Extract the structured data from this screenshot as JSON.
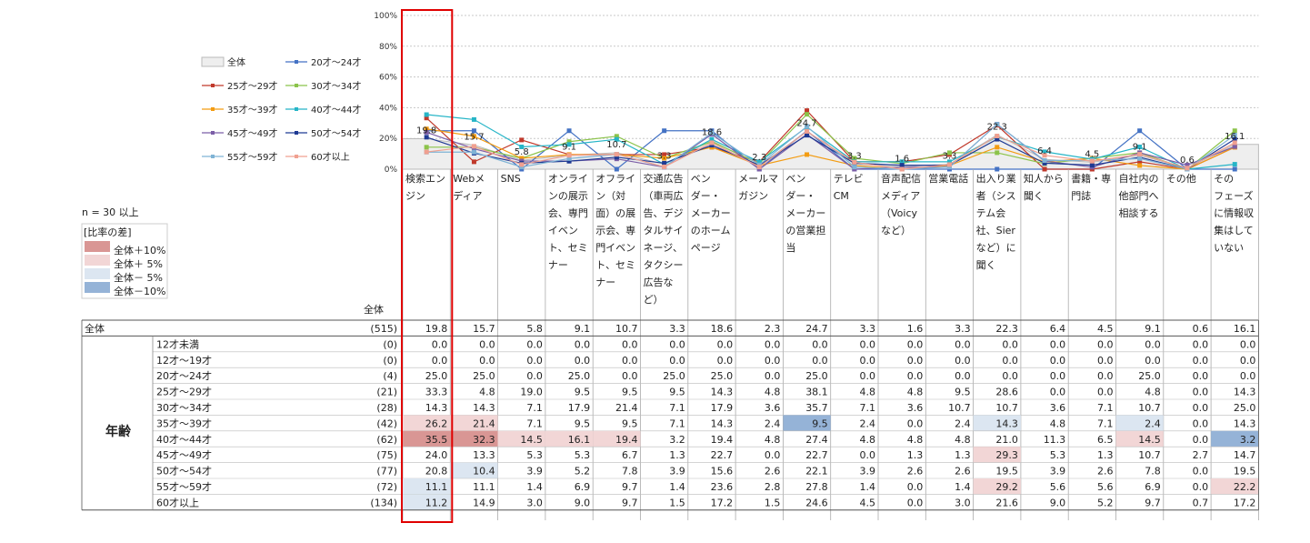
{
  "sample_note": "n = 30 以上",
  "diff_legend": {
    "title": "[比率の差]",
    "items": [
      {
        "label": "全体＋10%",
        "color": "#d99694"
      },
      {
        "label": "全体＋ 5%",
        "color": "#f2d6d6"
      },
      {
        "label": "全体－ 5%",
        "color": "#dce6f1"
      },
      {
        "label": "全体－10%",
        "color": "#95b3d7"
      }
    ]
  },
  "total_header": "全体",
  "group_label": "年齢",
  "colors": {
    "overall_fill": "#eeeeee",
    "highlight_box": "#e00000",
    "grid": "#c8c8c8"
  },
  "chart_data": {
    "type": "line",
    "yticks": [
      "100%",
      "80%",
      "60%",
      "40%",
      "20%",
      "0%"
    ],
    "ylim": [
      0,
      100
    ],
    "categories": [
      "検索エンジン",
      "Webメディア",
      "SNS",
      "オンラインの展示会、専門イベント、セミナー",
      "オフライン（対面）の展示会、専門イベント、セミナー",
      "交通広告（車両広告、デジタルサイネージ、タクシー広告など）",
      "ベンダー・メーカーのホームページ",
      "メールマガジン",
      "ベンダー・メーカーの営業担当",
      "テレビCM",
      "音声配信メディア（Voicyなど）",
      "営業電話",
      "出入り業者（システム会社、Sierなど）に聞く",
      "知人から聞く",
      "書籍・専門誌",
      "自社内の他部門へ相談する",
      "その他",
      "そのフェーズに情報収集はしていない"
    ],
    "category_lines": [
      [
        "検索エン",
        "ジン"
      ],
      [
        "Webメ",
        "ディア"
      ],
      [
        "SNS"
      ],
      [
        "オンライ",
        "ンの展示",
        "会、専門",
        "イベン",
        "ト、セミ",
        "ナー"
      ],
      [
        "オフライ",
        "ン（対",
        "面）の展",
        "示会、専",
        "門イベン",
        "ト、セミ",
        "ナー"
      ],
      [
        "交通広告",
        "（車両広",
        "告、デジ",
        "タルサイ",
        "ネージ、",
        "タクシー",
        "広告な",
        "ど）"
      ],
      [
        "ベン",
        "ダー・",
        "メーカー",
        "のホーム",
        "ページ"
      ],
      [
        "メールマ",
        "ガジン"
      ],
      [
        "ベン",
        "ダー・",
        "メーカー",
        "の営業担",
        "当"
      ],
      [
        "テレビ",
        "CM"
      ],
      [
        "音声配信",
        "メディア",
        "（Voicy",
        "など）"
      ],
      [
        "営業電話"
      ],
      [
        "出入り業",
        "者（シス",
        "テム会",
        "社、Sier",
        "など）に",
        "聞く"
      ],
      [
        "知人から",
        "聞く"
      ],
      [
        "書籍・専",
        "門誌"
      ],
      [
        "自社内の",
        "他部門へ",
        "相談する"
      ],
      [
        "その他"
      ],
      [
        "その",
        "フェーズ",
        "に情報収",
        "集はして",
        "いない"
      ]
    ],
    "overall": {
      "name": "全体",
      "n": "(515)",
      "values": [
        19.8,
        15.7,
        5.8,
        9.1,
        10.7,
        3.3,
        18.6,
        2.3,
        24.7,
        3.3,
        1.6,
        3.3,
        22.3,
        6.4,
        4.5,
        9.1,
        0.6,
        16.1
      ],
      "labels": [
        "19.8",
        "15.7",
        "5.8",
        "9.1",
        "10.7",
        "3.3",
        "18.6",
        "2.3",
        "24.7",
        "3.3",
        "1.6",
        "3.3",
        "22.3",
        "6.4",
        "4.5",
        "9.1",
        "0.6",
        "16.1"
      ]
    },
    "rows": [
      {
        "name": "12才未満",
        "n": "(0)",
        "in_chart": false,
        "color": "#999999",
        "values": [
          0.0,
          0.0,
          0.0,
          0.0,
          0.0,
          0.0,
          0.0,
          0.0,
          0.0,
          0.0,
          0.0,
          0.0,
          0.0,
          0.0,
          0.0,
          0.0,
          0.0,
          0.0
        ],
        "diff": [
          0,
          0,
          0,
          0,
          0,
          0,
          0,
          0,
          0,
          0,
          0,
          0,
          0,
          0,
          0,
          0,
          0,
          0
        ]
      },
      {
        "name": "12才～19才",
        "n": "(0)",
        "in_chart": false,
        "color": "#999999",
        "values": [
          0.0,
          0.0,
          0.0,
          0.0,
          0.0,
          0.0,
          0.0,
          0.0,
          0.0,
          0.0,
          0.0,
          0.0,
          0.0,
          0.0,
          0.0,
          0.0,
          0.0,
          0.0
        ],
        "diff": [
          0,
          0,
          0,
          0,
          0,
          0,
          0,
          0,
          0,
          0,
          0,
          0,
          0,
          0,
          0,
          0,
          0,
          0
        ]
      },
      {
        "name": "20才～24才",
        "n": "(4)",
        "in_chart": true,
        "color": "#4472c4",
        "values": [
          25.0,
          25.0,
          0.0,
          25.0,
          0.0,
          25.0,
          25.0,
          0.0,
          25.0,
          0.0,
          0.0,
          0.0,
          0.0,
          0.0,
          0.0,
          25.0,
          0.0,
          0.0
        ],
        "diff": [
          0,
          0,
          0,
          0,
          0,
          0,
          0,
          0,
          0,
          0,
          0,
          0,
          0,
          0,
          0,
          0,
          0,
          0
        ]
      },
      {
        "name": "25才～29才",
        "n": "(21)",
        "in_chart": true,
        "color": "#c0392b",
        "values": [
          33.3,
          4.8,
          19.0,
          9.5,
          9.5,
          9.5,
          14.3,
          4.8,
          38.1,
          4.8,
          4.8,
          9.5,
          28.6,
          0.0,
          0.0,
          4.8,
          0.0,
          14.3
        ],
        "diff": [
          0,
          0,
          0,
          0,
          0,
          0,
          0,
          0,
          0,
          0,
          0,
          0,
          0,
          0,
          0,
          0,
          0,
          0
        ]
      },
      {
        "name": "30才～34才",
        "n": "(28)",
        "in_chart": true,
        "color": "#8bc34a",
        "values": [
          14.3,
          14.3,
          7.1,
          17.9,
          21.4,
          7.1,
          17.9,
          3.6,
          35.7,
          7.1,
          3.6,
          10.7,
          10.7,
          3.6,
          7.1,
          10.7,
          0.0,
          25.0
        ],
        "diff": [
          0,
          0,
          0,
          0,
          0,
          0,
          0,
          0,
          0,
          0,
          0,
          0,
          0,
          0,
          0,
          0,
          0,
          0
        ]
      },
      {
        "name": "35才～39才",
        "n": "(42)",
        "in_chart": true,
        "color": "#f39c12",
        "values": [
          26.2,
          21.4,
          7.1,
          9.5,
          9.5,
          7.1,
          14.3,
          2.4,
          9.5,
          2.4,
          0.0,
          2.4,
          14.3,
          4.8,
          7.1,
          2.4,
          0.0,
          14.3
        ],
        "diff": [
          1,
          1,
          0,
          0,
          0,
          0,
          0,
          0,
          -2,
          0,
          0,
          0,
          -1,
          0,
          0,
          -1,
          0,
          0
        ]
      },
      {
        "name": "40才～44才",
        "n": "(62)",
        "in_chart": true,
        "color": "#26b5c7",
        "values": [
          35.5,
          32.3,
          14.5,
          16.1,
          19.4,
          3.2,
          19.4,
          4.8,
          27.4,
          4.8,
          4.8,
          4.8,
          21.0,
          11.3,
          6.5,
          14.5,
          0.0,
          3.2
        ],
        "diff": [
          2,
          2,
          1,
          1,
          1,
          0,
          0,
          0,
          0,
          0,
          0,
          0,
          0,
          0,
          0,
          1,
          0,
          -2
        ]
      },
      {
        "name": "45才～49才",
        "n": "(75)",
        "in_chart": true,
        "color": "#7b5ea7",
        "values": [
          24.0,
          13.3,
          5.3,
          5.3,
          6.7,
          1.3,
          22.7,
          0.0,
          22.7,
          0.0,
          1.3,
          1.3,
          29.3,
          5.3,
          1.3,
          10.7,
          2.7,
          14.7
        ],
        "diff": [
          0,
          0,
          0,
          0,
          0,
          0,
          0,
          0,
          0,
          0,
          0,
          0,
          1,
          0,
          0,
          0,
          0,
          0
        ]
      },
      {
        "name": "50才～54才",
        "n": "(77)",
        "in_chart": true,
        "color": "#1f3a93",
        "values": [
          20.8,
          10.4,
          3.9,
          5.2,
          7.8,
          3.9,
          15.6,
          2.6,
          22.1,
          3.9,
          2.6,
          2.6,
          19.5,
          3.9,
          2.6,
          7.8,
          0.0,
          19.5
        ],
        "diff": [
          0,
          -1,
          0,
          0,
          0,
          0,
          0,
          0,
          0,
          0,
          0,
          0,
          0,
          0,
          0,
          0,
          0,
          0
        ]
      },
      {
        "name": "55才～59才",
        "n": "(72)",
        "in_chart": true,
        "color": "#7fb3d5",
        "values": [
          11.1,
          11.1,
          1.4,
          6.9,
          9.7,
          1.4,
          23.6,
          2.8,
          27.8,
          1.4,
          0.0,
          1.4,
          29.2,
          5.6,
          5.6,
          6.9,
          0.0,
          22.2
        ],
        "diff": [
          -1,
          0,
          0,
          0,
          0,
          0,
          0,
          0,
          0,
          0,
          0,
          0,
          1,
          0,
          0,
          0,
          0,
          1
        ]
      },
      {
        "name": "60才以上",
        "n": "(134)",
        "in_chart": true,
        "color": "#f0a090",
        "values": [
          11.2,
          14.9,
          3.0,
          9.0,
          9.7,
          1.5,
          17.2,
          1.5,
          24.6,
          4.5,
          0.0,
          3.0,
          21.6,
          9.0,
          5.2,
          9.7,
          0.7,
          17.2
        ],
        "diff": [
          -1,
          0,
          0,
          0,
          0,
          0,
          0,
          0,
          0,
          0,
          0,
          0,
          0,
          0,
          0,
          0,
          0,
          0
        ]
      }
    ],
    "display": [
      [
        "19.8",
        "15.7",
        "5.8",
        "9.1",
        "10.7",
        "3.3",
        "18.6",
        "2.3",
        "24.7",
        "3.3",
        "1.6",
        "3.3",
        "22.3",
        "6.4",
        "4.5",
        "9.1",
        "0.6",
        "16.1"
      ],
      [
        "0.0",
        "0.0",
        "0.0",
        "0.0",
        "0.0",
        "0.0",
        "0.0",
        "0.0",
        "0.0",
        "0.0",
        "0.0",
        "0.0",
        "0.0",
        "0.0",
        "0.0",
        "0.0",
        "0.0",
        "0.0"
      ],
      [
        "0.0",
        "0.0",
        "0.0",
        "0.0",
        "0.0",
        "0.0",
        "0.0",
        "0.0",
        "0.0",
        "0.0",
        "0.0",
        "0.0",
        "0.0",
        "0.0",
        "0.0",
        "0.0",
        "0.0",
        "0.0"
      ],
      [
        "25.0",
        "25.0",
        "0.0",
        "25.0",
        "0.0",
        "25.0",
        "25.0",
        "0.0",
        "25.0",
        "0.0",
        "0.0",
        "0.0",
        "0.0",
        "0.0",
        "0.0",
        "25.0",
        "0.0",
        "0.0"
      ],
      [
        "33.3",
        "4.8",
        "19.0",
        "9.5",
        "9.5",
        "9.5",
        "14.3",
        "4.8",
        "38.1",
        "4.8",
        "4.8",
        "9.5",
        "28.6",
        "0.0",
        "0.0",
        "4.8",
        "0.0",
        "14.3"
      ],
      [
        "14.3",
        "14.3",
        "7.1",
        "17.9",
        "21.4",
        "7.1",
        "17.9",
        "3.6",
        "35.7",
        "7.1",
        "3.6",
        "10.7",
        "10.7",
        "3.6",
        "7.1",
        "10.7",
        "0.0",
        "25.0"
      ],
      [
        "26.2",
        "21.4",
        "7.1",
        "9.5",
        "9.5",
        "7.1",
        "14.3",
        "2.4",
        "9.5",
        "2.4",
        "0.0",
        "2.4",
        "14.3",
        "4.8",
        "7.1",
        "2.4",
        "0.0",
        "14.3"
      ],
      [
        "35.5",
        "32.3",
        "14.5",
        "16.1",
        "19.4",
        "3.2",
        "19.4",
        "4.8",
        "27.4",
        "4.8",
        "4.8",
        "4.8",
        "21.0",
        "11.3",
        "6.5",
        "14.5",
        "0.0",
        "3.2"
      ],
      [
        "24.0",
        "13.3",
        "5.3",
        "5.3",
        "6.7",
        "1.3",
        "22.7",
        "0.0",
        "22.7",
        "0.0",
        "1.3",
        "1.3",
        "29.3",
        "5.3",
        "1.3",
        "10.7",
        "2.7",
        "14.7"
      ],
      [
        "20.8",
        "10.4",
        "3.9",
        "5.2",
        "7.8",
        "3.9",
        "15.6",
        "2.6",
        "22.1",
        "3.9",
        "2.6",
        "2.6",
        "19.5",
        "3.9",
        "2.6",
        "7.8",
        "0.0",
        "19.5"
      ],
      [
        "11.1",
        "11.1",
        "1.4",
        "6.9",
        "9.7",
        "1.4",
        "23.6",
        "2.8",
        "27.8",
        "1.4",
        "0.0",
        "1.4",
        "29.2",
        "5.6",
        "5.6",
        "6.9",
        "0.0",
        "22.2"
      ],
      [
        "11.2",
        "14.9",
        "3.0",
        "9.0",
        "9.7",
        "1.5",
        "17.2",
        "1.5",
        "24.6",
        "4.5",
        "0.0",
        "3.0",
        "21.6",
        "9.0",
        "5.2",
        "9.7",
        "0.7",
        "17.2"
      ]
    ],
    "legend": [
      "全体",
      "20才～24才",
      "25才～29才",
      "30才～34才",
      "35才～39才",
      "40才～44才",
      "45才～49才",
      "50才～54才",
      "55才～59才",
      "60才以上"
    ]
  }
}
